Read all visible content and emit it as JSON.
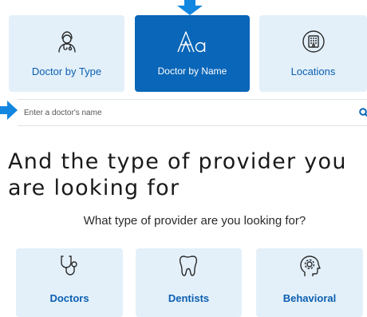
{
  "search_tabs": [
    {
      "label": "Doctor by Type",
      "icon": "doctor-icon",
      "active": false
    },
    {
      "label": "Doctor by Name",
      "icon": "text-aa-icon",
      "active": true
    },
    {
      "label": "Locations",
      "icon": "building-icon",
      "active": false
    }
  ],
  "search": {
    "placeholder": "Enter a doctor's name",
    "icon": "search-icon"
  },
  "heading": "And the type of provider you are looking for",
  "question": "What type of provider are you looking for?",
  "provider_types": [
    {
      "label": "Doctors",
      "icon": "stethoscope-icon"
    },
    {
      "label": "Dentists",
      "icon": "tooth-icon"
    },
    {
      "label": "Behavioral",
      "icon": "head-gear-icon"
    }
  ],
  "colors": {
    "accent": "#0a66b8",
    "tile_bg": "#e3f0fa",
    "arrow": "#1387e0"
  }
}
